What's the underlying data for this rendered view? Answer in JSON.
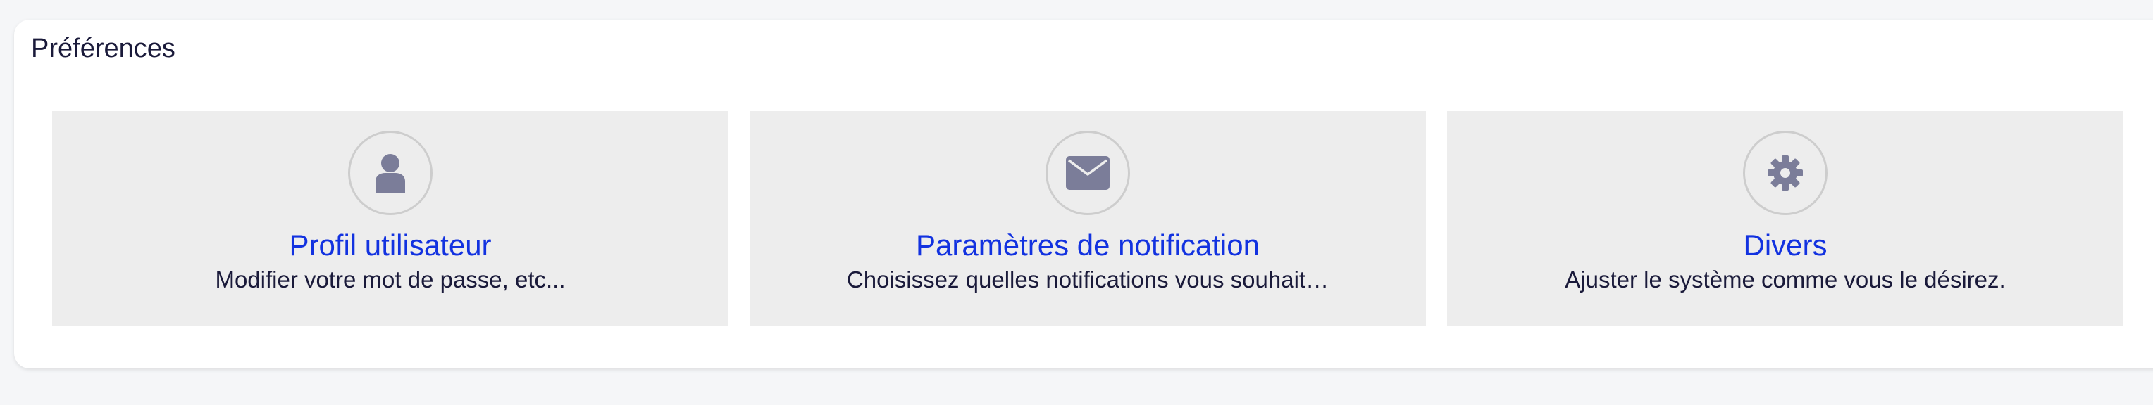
{
  "section": {
    "title": "Préférences"
  },
  "tiles": [
    {
      "icon": "user-icon",
      "title": "Profil utilisateur",
      "description": "Modifier votre mot de passe, etc..."
    },
    {
      "icon": "envelope-icon",
      "title": "Paramètres de notification",
      "description": "Choisissez quelles notifications vous souhait…"
    },
    {
      "icon": "gear-icon",
      "title": "Divers",
      "description": "Ajuster le système comme vous le désirez."
    }
  ],
  "colors": {
    "page_background": "#f5f6f8",
    "tile_background": "#ededed",
    "link": "#1232e0",
    "icon": "#7b7d99",
    "icon_ring": "#cdcdcd"
  }
}
